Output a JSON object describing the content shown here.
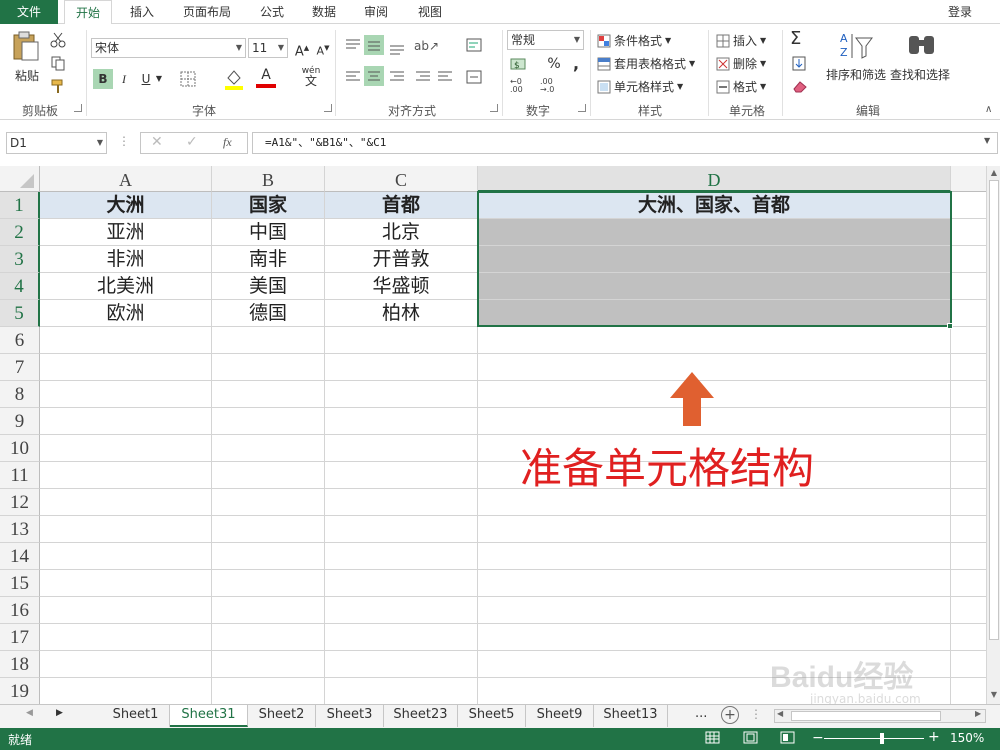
{
  "ribbon_tabs": [
    "文件",
    "开始",
    "插入",
    "页面布局",
    "公式",
    "数据",
    "审阅",
    "视图"
  ],
  "login_label": "登录",
  "clipboard": {
    "paste_label": "粘贴",
    "group": "剪贴板"
  },
  "font": {
    "name": "宋体",
    "size": "11",
    "group": "字体",
    "wen_label": "wén",
    "bold": "B",
    "italic": "I",
    "underline": "U"
  },
  "alignment": {
    "group": "对齐方式"
  },
  "number": {
    "format": "常规",
    "percent": "%",
    "comma": ",",
    "group": "数字"
  },
  "styles": {
    "conditional": "条件格式",
    "table_format": "套用表格格式",
    "cell_styles": "单元格样式",
    "group": "样式"
  },
  "cells": {
    "insert": "插入",
    "delete": "删除",
    "format": "格式",
    "group": "单元格"
  },
  "editing": {
    "sort_filter": "排序和筛选",
    "find_select": "查找和选择",
    "group": "编辑"
  },
  "formula_bar": {
    "name_box": "D1",
    "fx": "fx",
    "formula": "=A1&\"、\"&B1&\"、\"&C1"
  },
  "columns": [
    "A",
    "B",
    "C",
    "D"
  ],
  "rows": [
    "1",
    "2",
    "3",
    "4",
    "5",
    "6",
    "7",
    "8",
    "9",
    "10",
    "11",
    "12",
    "13",
    "14",
    "15",
    "16",
    "17",
    "18",
    "19"
  ],
  "table": [
    [
      "大洲",
      "国家",
      "首都",
      "大洲、国家、首都"
    ],
    [
      "亚洲",
      "中国",
      "北京",
      ""
    ],
    [
      "非洲",
      "南非",
      "开普敦",
      ""
    ],
    [
      "北美洲",
      "美国",
      "华盛顿",
      ""
    ],
    [
      "欧洲",
      "德国",
      "柏林",
      ""
    ]
  ],
  "annotation": {
    "text": "准备单元格结构",
    "color": "#e02020",
    "arrow_color": "#e06030"
  },
  "sheets": [
    "Sheet1",
    "Sheet31",
    "Sheet2",
    "Sheet3",
    "Sheet23",
    "Sheet5",
    "Sheet9",
    "Sheet13"
  ],
  "active_sheet": "Sheet31",
  "sheet_more": "...",
  "status": {
    "ready": "就绪",
    "zoom": "150%"
  },
  "watermark": {
    "brand": "Baidu经验",
    "url": "jingyan.baidu.com"
  },
  "colors": {
    "excel_green": "#217346",
    "header_fill": "#dce6f1",
    "gray_fill": "#c0c0c0"
  }
}
